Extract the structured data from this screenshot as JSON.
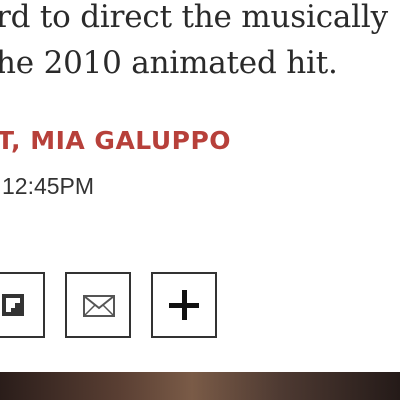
{
  "article": {
    "dek_lines": [
      "rd to direct the musically",
      "he 2010 animated hit."
    ],
    "byline": "T, MIA GALUPPO",
    "timestamp": "12:45PM"
  },
  "share_bar": {
    "buttons": [
      {
        "icon": "flipboard-icon"
      },
      {
        "icon": "email-icon"
      },
      {
        "icon": "plus-icon"
      }
    ]
  },
  "colors": {
    "byline": "#b7403a",
    "text": "#2a2a2a",
    "border": "#333333"
  }
}
